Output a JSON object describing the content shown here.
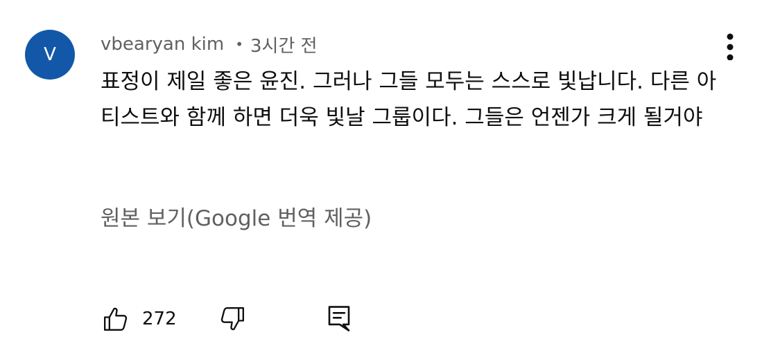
{
  "comment": {
    "avatar_letter": "V",
    "avatar_color": "#1358a8",
    "author": "vbearyan kim",
    "separator": "•",
    "time_ago": "3시간 전",
    "text": "표정이 제일 좋은 윤진. 그러나 그들 모두는 스스로 빛납니다. 다른 아티스트와 함께 하면 더욱 빛날 그룹이다. 그들은 언젠가 크게 될거야",
    "translation_note": "원본 보기(Google 번역 제공)",
    "like_count": "272"
  },
  "icons": {
    "more": "more-vertical-icon",
    "like": "thumbs-up-icon",
    "dislike": "thumbs-down-icon",
    "reply": "reply-comment-icon"
  },
  "colors": {
    "text_primary": "#0f0f0f",
    "text_secondary": "#606060",
    "background": "#ffffff"
  }
}
